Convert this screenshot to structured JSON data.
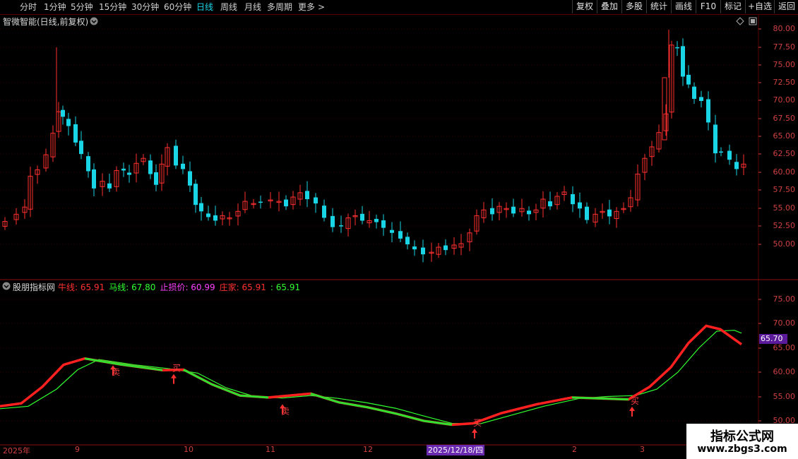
{
  "toolbar": {
    "periods": [
      "分时",
      "1分钟",
      "5分钟",
      "15分钟",
      "30分钟",
      "60分钟",
      "日线",
      "周线",
      "月线",
      "多周期",
      "更多"
    ],
    "active_period": "日线",
    "more_arrow": ">",
    "actions": [
      "复权",
      "叠加",
      "多股",
      "统计",
      "画线",
      "F10",
      "标记",
      "+自选",
      "返回"
    ]
  },
  "main_panel": {
    "title": "智微智能(日线,前复权)",
    "axis_ticks": [
      "80.00",
      "77.50",
      "75.00",
      "72.50",
      "70.00",
      "67.50",
      "65.00",
      "62.50",
      "60.00",
      "57.50",
      "55.00",
      "52.50",
      "50.00"
    ]
  },
  "indicator_panel": {
    "name": "股朋指标网",
    "legend": [
      {
        "label": "牛线: 65.91",
        "color": "#ff3030"
      },
      {
        "label": "马线: 67.80",
        "color": "#30ff30"
      },
      {
        "label": "止损价: 60.99",
        "color": "#ff40ff"
      },
      {
        "label": "庄家: 65.91",
        "color": "#ff3030"
      },
      {
        "label": ": 65.91",
        "color": "#30ff30"
      }
    ],
    "axis_ticks": [
      "75.00",
      "70.00",
      "65.00",
      "60.00",
      "55.00",
      "50.00"
    ],
    "current_value": "65.70",
    "signals": [
      "买",
      "卖",
      "卖",
      "买",
      "买"
    ]
  },
  "x_axis": {
    "labels": [
      "2025年",
      "9",
      "10",
      "11",
      "12",
      "2",
      "3"
    ],
    "cursor_date": "2025/12/18/四"
  },
  "watermark": {
    "line1": "指标公式网",
    "line2": "www.zbgs3.com"
  },
  "colors": {
    "up": "#ff3030",
    "down": "#19d5e6",
    "grid": "#5a0000"
  }
}
